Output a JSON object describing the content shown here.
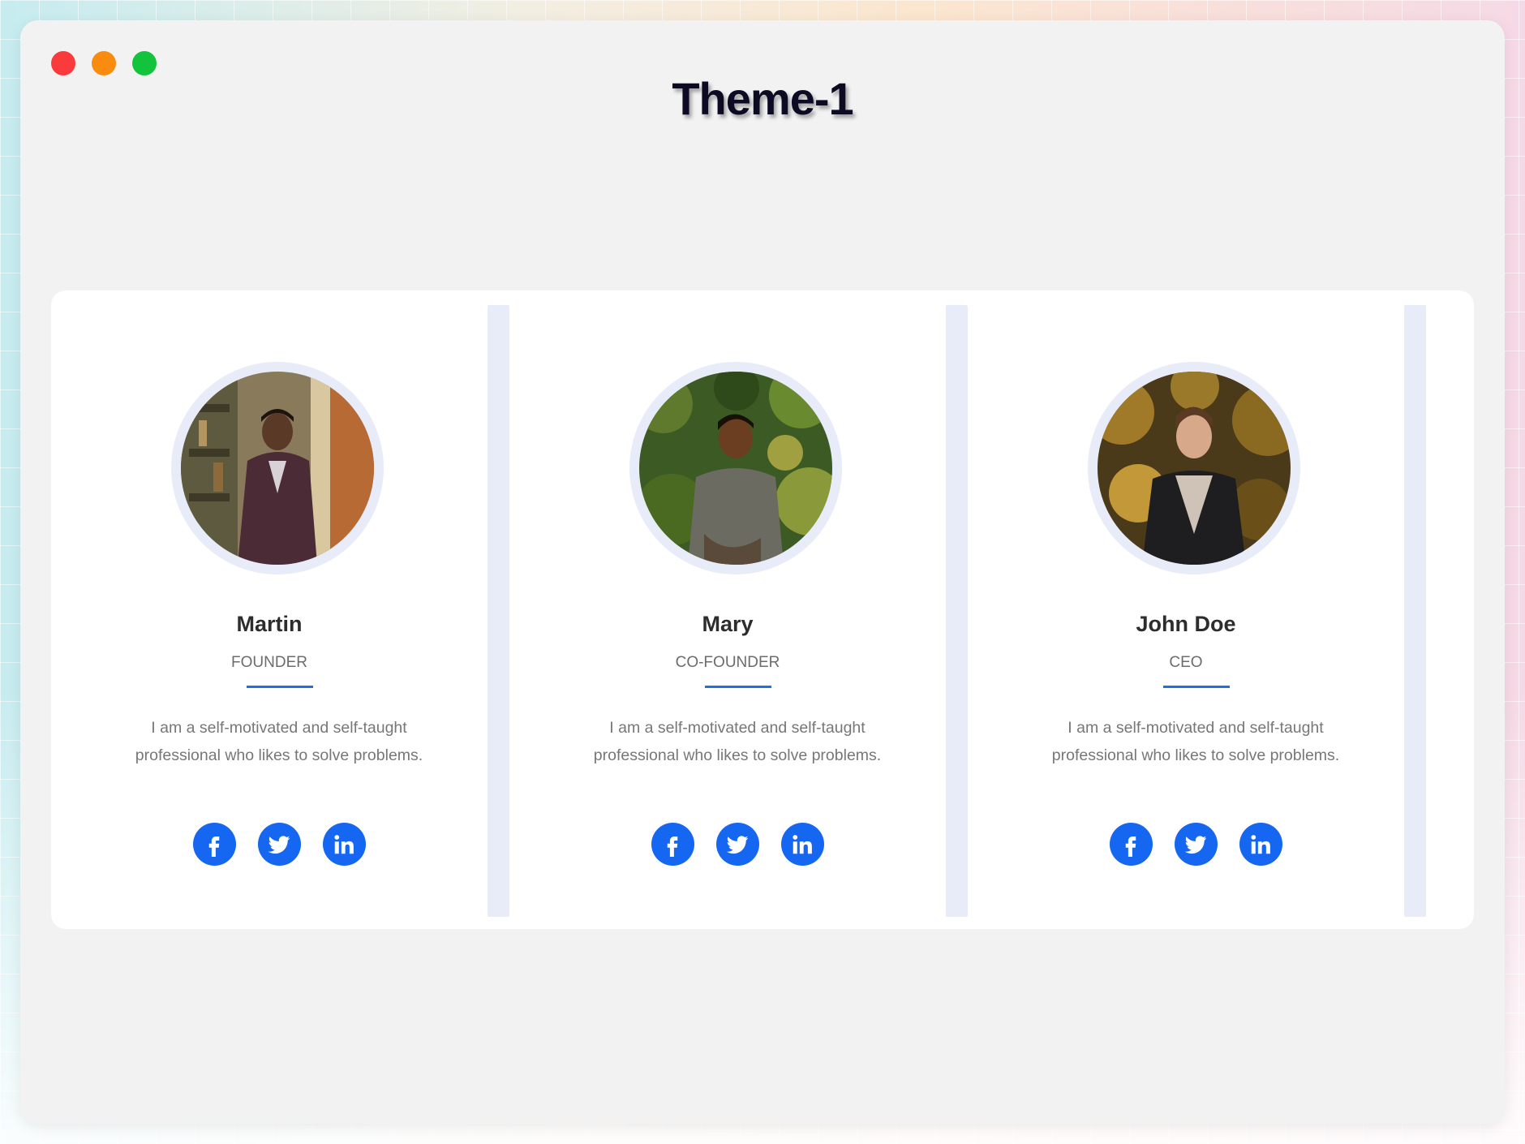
{
  "window": {
    "title": "Theme-1"
  },
  "team": [
    {
      "name": "Martin",
      "role": "FOUNDER",
      "bio": "I am a self-motivated and self-taught professional who likes to solve problems.",
      "socials": [
        "facebook-icon",
        "twitter-icon",
        "linkedin-icon"
      ]
    },
    {
      "name": "Mary",
      "role": "CO-FOUNDER",
      "bio": "I am a self-motivated and self-taught professional who likes to solve problems.",
      "socials": [
        "facebook-icon",
        "twitter-icon",
        "linkedin-icon"
      ]
    },
    {
      "name": "John Doe",
      "role": "CEO",
      "bio": "I am a self-motivated and self-taught professional who likes to solve problems.",
      "socials": [
        "facebook-icon",
        "twitter-icon",
        "linkedin-icon"
      ]
    }
  ],
  "colors": {
    "accent": "#1566f0",
    "underline": "#1f6fe6",
    "divider": "#e8ecf9",
    "title": "#0d0b24"
  }
}
